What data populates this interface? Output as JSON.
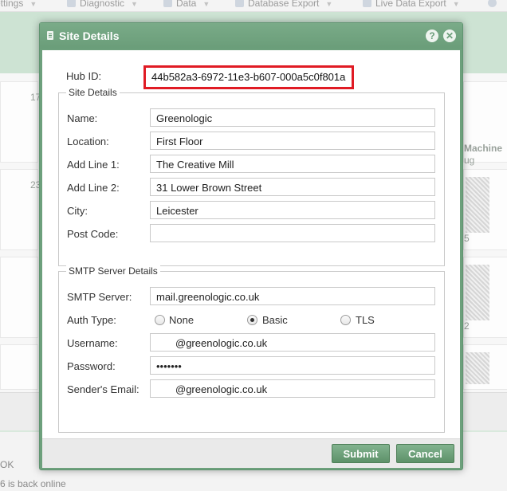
{
  "background": {
    "toolbar_tabs": [
      {
        "label": "ettings",
        "icon": "settings-icon"
      },
      {
        "label": "Diagnostic",
        "icon": "diagnostic-icon"
      },
      {
        "label": "Data",
        "icon": "data-icon"
      },
      {
        "label": "Database Export",
        "icon": "database-export-icon"
      },
      {
        "label": "Live Data Export",
        "icon": "live-data-export-icon"
      }
    ],
    "card_text_1": "Machine",
    "card_text_2": "ug",
    "side_num_1": "17",
    "side_num_2": "23",
    "side_num_3": "5",
    "side_num_4": "2",
    "status_ok": "OK",
    "status_online": "6 is back online"
  },
  "dialog": {
    "title": "Site Details",
    "icon": "document-icon",
    "help_icon": "help-icon",
    "close_icon": "close-icon",
    "hub_id_label": "Hub ID:",
    "hub_id_value": "44b582a3-6972-11e3-b607-000a5c0f801a",
    "site_details": {
      "legend": "Site Details",
      "fields": [
        {
          "label": "Name:",
          "value": "Greenologic"
        },
        {
          "label": "Location:",
          "value": "First Floor"
        },
        {
          "label": "Add Line 1:",
          "value": "The Creative Mill"
        },
        {
          "label": "Add Line 2:",
          "value": "31 Lower Brown Street"
        },
        {
          "label": "City:",
          "value": "Leicester"
        },
        {
          "label": "Post Code:",
          "value": ""
        }
      ]
    },
    "smtp": {
      "legend": "SMTP Server Details",
      "server_label": "SMTP Server:",
      "server_value": "mail.greenologic.co.uk",
      "auth_label": "Auth Type:",
      "auth_options": [
        "None",
        "Basic",
        "TLS"
      ],
      "auth_selected": "Basic",
      "username_label": "Username:",
      "username_value": "@greenologic.co.uk",
      "password_label": "Password:",
      "password_value": "•••••••",
      "sender_label": "Sender's Email:",
      "sender_value": "@greenologic.co.uk"
    },
    "submit_label": "Submit",
    "cancel_label": "Cancel"
  },
  "colors": {
    "accent": "#6da07c",
    "highlight_box": "#e01b24"
  }
}
